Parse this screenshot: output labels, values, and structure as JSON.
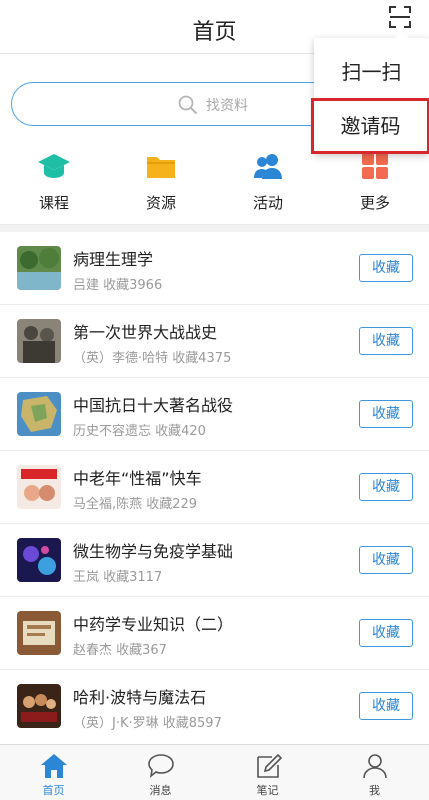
{
  "header": {
    "title": "首页",
    "scan_icon": "scan-icon"
  },
  "search": {
    "placeholder": "找资料",
    "icon": "search-icon"
  },
  "quick_links": [
    {
      "label": "课程",
      "icon": "graduation-cap-icon",
      "color": "#1fbfa6"
    },
    {
      "label": "资源",
      "icon": "folder-icon",
      "color": "#f5b21b"
    },
    {
      "label": "活动",
      "icon": "people-icon",
      "color": "#2c86d6"
    },
    {
      "label": "更多",
      "icon": "grid-icon",
      "color": "#f26a4f"
    }
  ],
  "items": [
    {
      "title": "病理生理学",
      "subtitle": "吕建 收藏3966",
      "action": "收藏"
    },
    {
      "title": "第一次世界大战战史",
      "subtitle": "（英）李德·哈特 收藏4375",
      "action": "收藏"
    },
    {
      "title": "中国抗日十大著名战役",
      "subtitle": "历史不容遗忘 收藏420",
      "action": "收藏"
    },
    {
      "title": "中老年“性福”快车",
      "subtitle": "马全福,陈燕 收藏229",
      "action": "收藏"
    },
    {
      "title": "微生物学与免疫学基础",
      "subtitle": "王岚 收藏3117",
      "action": "收藏"
    },
    {
      "title": "中药学专业知识（二）",
      "subtitle": "赵春杰 收藏367",
      "action": "收藏"
    },
    {
      "title": "哈利·波特与魔法石",
      "subtitle": "（英）J·K·罗琳 收藏8597",
      "action": "收藏"
    }
  ],
  "tabbar": [
    {
      "label": "首页",
      "icon": "home-icon",
      "active": true
    },
    {
      "label": "消息",
      "icon": "message-icon",
      "active": false
    },
    {
      "label": "笔记",
      "icon": "note-icon",
      "active": false
    },
    {
      "label": "我",
      "icon": "user-icon",
      "active": false
    }
  ],
  "popup_menu": {
    "items": [
      "扫一扫",
      "邀请码"
    ],
    "highlighted": "邀请码"
  },
  "colors": {
    "accent": "#2c86d6",
    "highlight_border": "#d6282c"
  }
}
